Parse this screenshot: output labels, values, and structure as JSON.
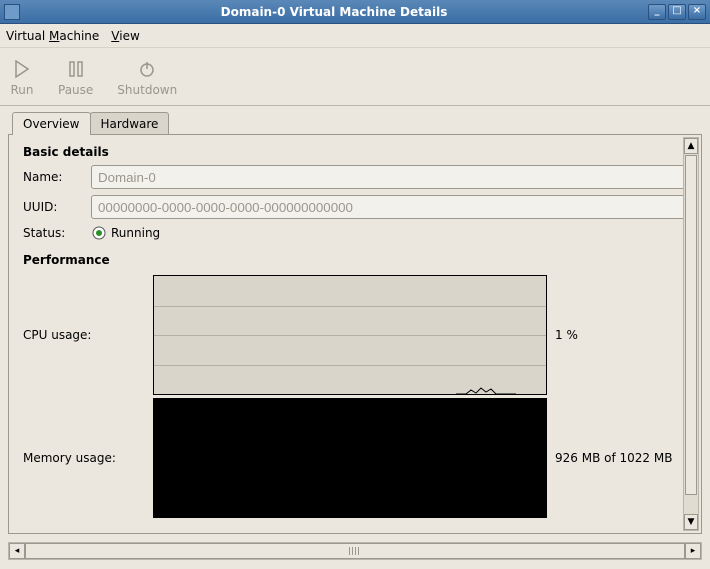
{
  "window": {
    "title": "Domain-0 Virtual Machine Details"
  },
  "menubar": {
    "vm": "Virtual Machine",
    "view": "View"
  },
  "toolbar": {
    "run": "Run",
    "pause": "Pause",
    "shutdown": "Shutdown"
  },
  "tabs": {
    "overview": "Overview",
    "hardware": "Hardware"
  },
  "basic": {
    "title": "Basic details",
    "name_label": "Name:",
    "name_value": "Domain-0",
    "uuid_label": "UUID:",
    "uuid_value": "00000000-0000-0000-0000-000000000000",
    "status_label": "Status:",
    "status_value": "Running"
  },
  "perf": {
    "title": "Performance",
    "cpu_label": "CPU usage:",
    "cpu_value": "1 %",
    "mem_label": "Memory usage:",
    "mem_value": "926 MB of 1022 MB"
  }
}
